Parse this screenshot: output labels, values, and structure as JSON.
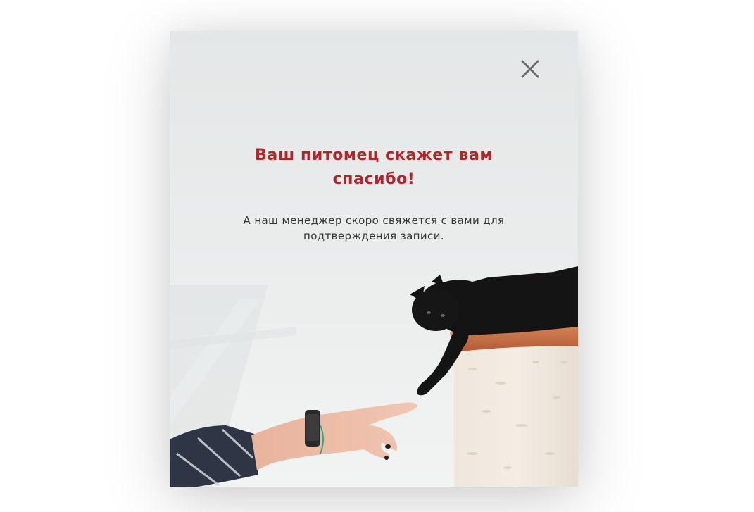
{
  "modal": {
    "title": "Ваш питомец скажет вам спасибо!",
    "message": "А наш менеджер скоро свяжется с вами для подтверждения записи.",
    "close_icon": "close-icon",
    "image_description": "photo-black-kitten-reaching-hand"
  },
  "colors": {
    "title": "#b0242a",
    "text": "#333333",
    "background": "#e6e8e8",
    "close_icon": "#6b6b6b"
  }
}
